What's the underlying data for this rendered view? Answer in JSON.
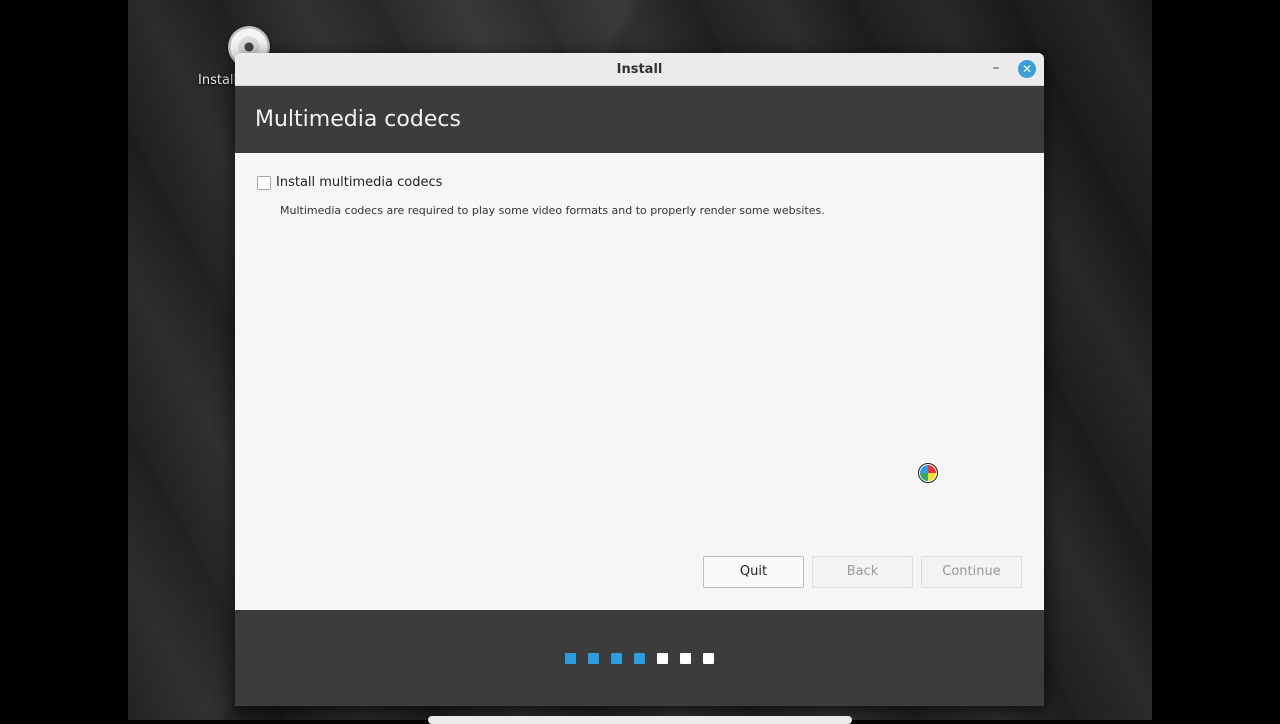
{
  "desktop": {
    "icon_name": "disc-icon",
    "icon_label": "Install"
  },
  "window": {
    "title": "Install",
    "minimize_label": "–",
    "close_label": "✕"
  },
  "header": {
    "title": "Multimedia codecs"
  },
  "content": {
    "checkbox_label": "Install multimedia codecs",
    "checkbox_checked": false,
    "description": "Multimedia codecs are required to play some video formats and to properly render some websites."
  },
  "buttons": {
    "quit": "Quit",
    "back": "Back",
    "continue": "Continue"
  },
  "progress": {
    "total_steps": 7,
    "completed_steps": 4,
    "done_color": "#2b9ee0",
    "todo_color": "#ffffff"
  }
}
